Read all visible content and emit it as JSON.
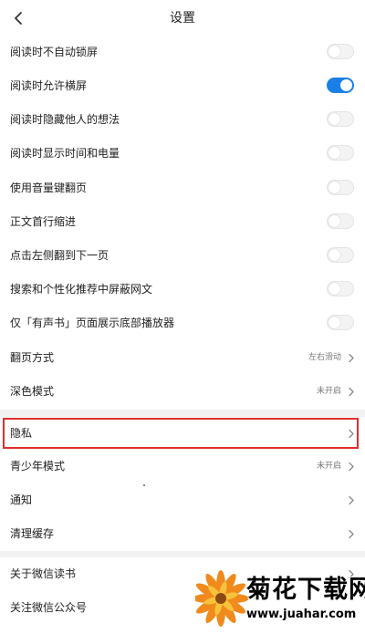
{
  "header": {
    "title": "设置"
  },
  "settings": [
    {
      "label": "阅读时不自动锁屏",
      "on": false
    },
    {
      "label": "阅读时允许横屏",
      "on": true
    },
    {
      "label": "阅读时隐藏他人的想法",
      "on": false
    },
    {
      "label": "阅读时显示时间和电量",
      "on": false
    },
    {
      "label": "使用音量键翻页",
      "on": false
    },
    {
      "label": "正文首行缩进",
      "on": false
    },
    {
      "label": "点击左侧翻到下一页",
      "on": false
    },
    {
      "label": "搜索和个性化推荐中屏蔽网文",
      "on": false
    },
    {
      "label": "仅「有声书」页面展示底部播放器",
      "on": false
    }
  ],
  "page_turn": {
    "label": "翻页方式",
    "value": "左右滑动"
  },
  "dark_mode": {
    "label": "深色模式",
    "value": "未开启"
  },
  "privacy": {
    "label": "隐私"
  },
  "teen_mode": {
    "label": "青少年模式",
    "value": "未开启"
  },
  "notifications": {
    "label": "通知"
  },
  "clear_cache": {
    "label": "清理缓存"
  },
  "about": {
    "label": "关于微信读书"
  },
  "follow": {
    "label": "关注微信公众号"
  },
  "watermark": {
    "title": "菊花下载网",
    "url": "www.juahar.com"
  },
  "colors": {
    "toggle_on": "#1a7fe6",
    "highlight": "#e12d2d",
    "separator": "#f2f2f2"
  }
}
